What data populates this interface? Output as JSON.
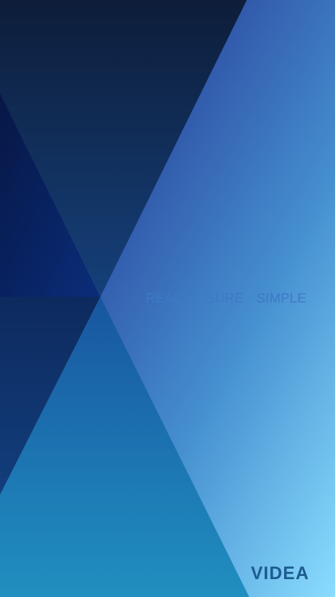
{
  "splash": {
    "tagline": {
      "word1": "REACH",
      "separator": "·",
      "word2": "SURE",
      "word3": "SIMPLE"
    },
    "logo": {
      "text": "VIDEA"
    }
  },
  "colors": {
    "tagline": "#3d79c6",
    "logo": "#1c5b90",
    "dark_navy": "#0d1f3d",
    "light_cyan": "#7fd6ff"
  }
}
